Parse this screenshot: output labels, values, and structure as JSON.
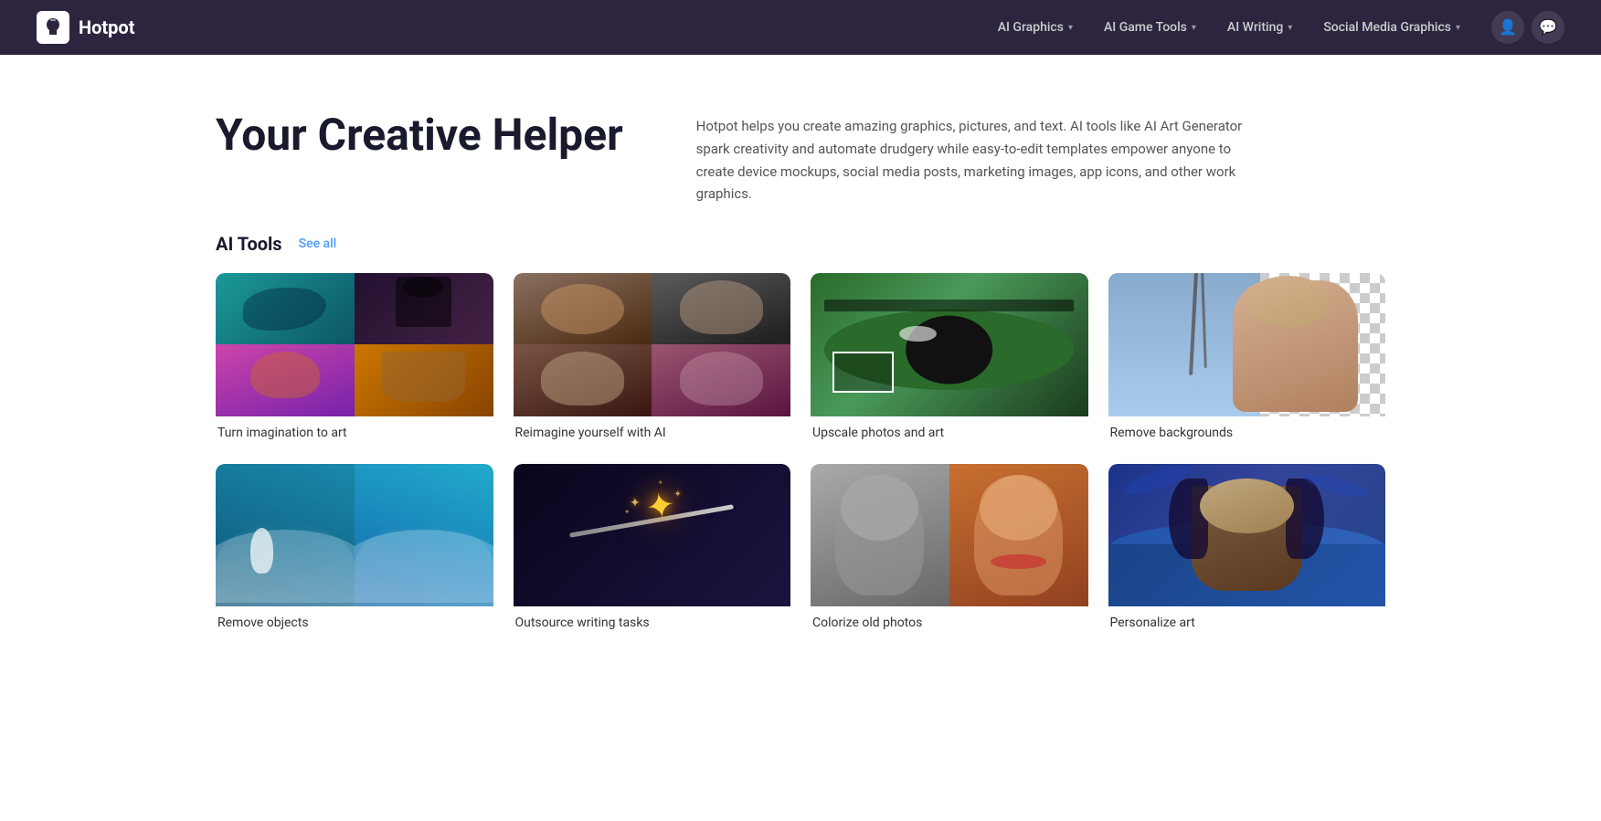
{
  "brand": {
    "name": "Hotpot",
    "logo_alt": "Hotpot logo"
  },
  "nav": {
    "links": [
      {
        "id": "ai-graphics",
        "label": "AI Graphics",
        "has_dropdown": true
      },
      {
        "id": "ai-game-tools",
        "label": "AI Game Tools",
        "has_dropdown": true
      },
      {
        "id": "ai-writing",
        "label": "AI Writing",
        "has_dropdown": true
      },
      {
        "id": "social-media",
        "label": "Social Media Graphics",
        "has_dropdown": true
      }
    ],
    "user_icon_label": "User account",
    "chat_icon_label": "Chat / messages"
  },
  "hero": {
    "title": "Your Creative Helper",
    "description": "Hotpot helps you create amazing graphics, pictures, and text. AI tools like AI Art Generator spark creativity and automate drudgery while easy-to-edit templates empower anyone to create device mockups, social media posts, marketing images, app icons, and other work graphics."
  },
  "ai_tools": {
    "section_title": "AI Tools",
    "see_all_label": "See all",
    "cards": [
      {
        "id": "turn-imagination",
        "label": "Turn imagination to art",
        "layout": "quad"
      },
      {
        "id": "reimagine-ai",
        "label": "Reimagine yourself with AI",
        "layout": "quad"
      },
      {
        "id": "upscale-photos",
        "label": "Upscale photos and art",
        "layout": "single"
      },
      {
        "id": "remove-backgrounds",
        "label": "Remove backgrounds",
        "layout": "single"
      },
      {
        "id": "remove-objects",
        "label": "Remove objects",
        "layout": "two-col"
      },
      {
        "id": "outsource-writing",
        "label": "Outsource writing tasks",
        "layout": "single-dark"
      },
      {
        "id": "colorize-photos",
        "label": "Colorize old photos",
        "layout": "two-col"
      },
      {
        "id": "personalize-art",
        "label": "Personalize art",
        "layout": "single-blue"
      }
    ]
  }
}
